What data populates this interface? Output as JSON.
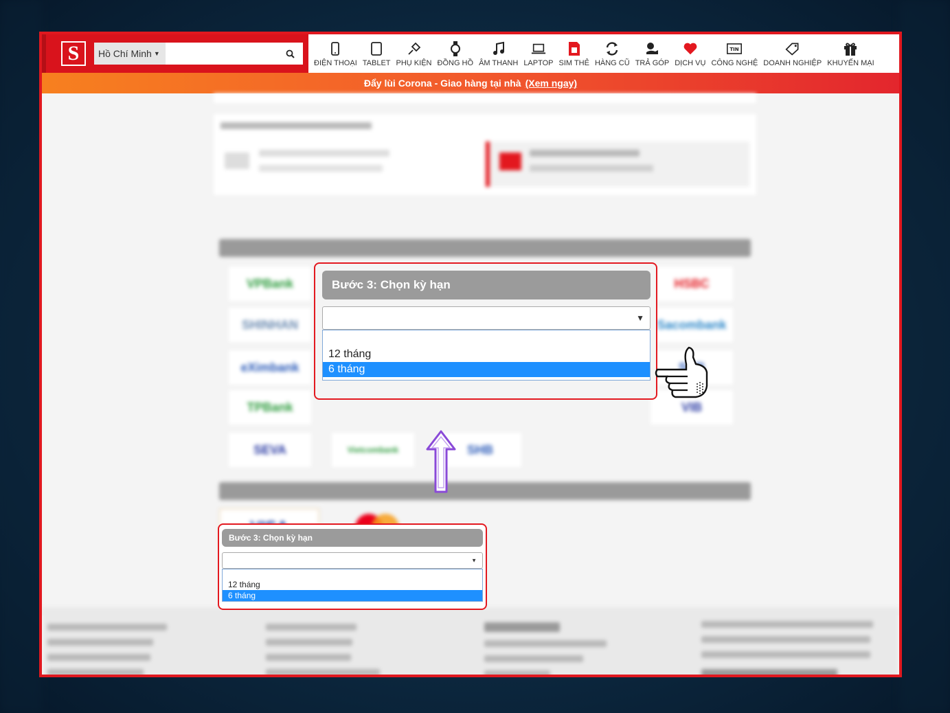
{
  "header": {
    "city": "Hồ Chí Minh",
    "search_placeholder": "",
    "nav": [
      {
        "label": "ĐIỆN THOẠI",
        "icon": "phone-icon"
      },
      {
        "label": "TABLET",
        "icon": "tablet-icon"
      },
      {
        "label": "PHỤ KIỆN",
        "icon": "accessory-icon"
      },
      {
        "label": "ĐỒNG HỒ",
        "icon": "watch-icon"
      },
      {
        "label": "ÂM THANH",
        "icon": "music-icon"
      },
      {
        "label": "LAPTOP",
        "icon": "laptop-icon"
      },
      {
        "label": "SIM THẺ",
        "icon": "sim-icon"
      },
      {
        "label": "HÀNG CŨ",
        "icon": "refresh-icon"
      },
      {
        "label": "TRẢ GÓP",
        "icon": "installment-icon"
      },
      {
        "label": "DỊCH VỤ",
        "icon": "service-icon"
      },
      {
        "label": "CÔNG NGHỆ",
        "icon": "news-icon"
      },
      {
        "label": "DOANH NGHIỆP",
        "icon": "tag-icon"
      },
      {
        "label": "KHUYẾN MẠI",
        "icon": "gift-icon"
      }
    ]
  },
  "promo": {
    "text": "Đẩy lùi Corona - Giao hàng tại nhà",
    "link": "(Xem ngay)"
  },
  "step_large": {
    "title": "Bước 3: Chọn kỳ hạn",
    "selected": "",
    "options": [
      "12 tháng",
      "6 tháng"
    ],
    "highlighted": "6 tháng"
  },
  "step_small": {
    "title": "Bước 3: Chọn kỳ hạn",
    "selected": "",
    "options": [
      "12 tháng",
      "6 tháng"
    ],
    "highlighted": "6 tháng"
  },
  "colors": {
    "brand_red": "#e3181f",
    "highlight_blue": "#1e90ff",
    "step_gray": "#9b9b9b"
  }
}
